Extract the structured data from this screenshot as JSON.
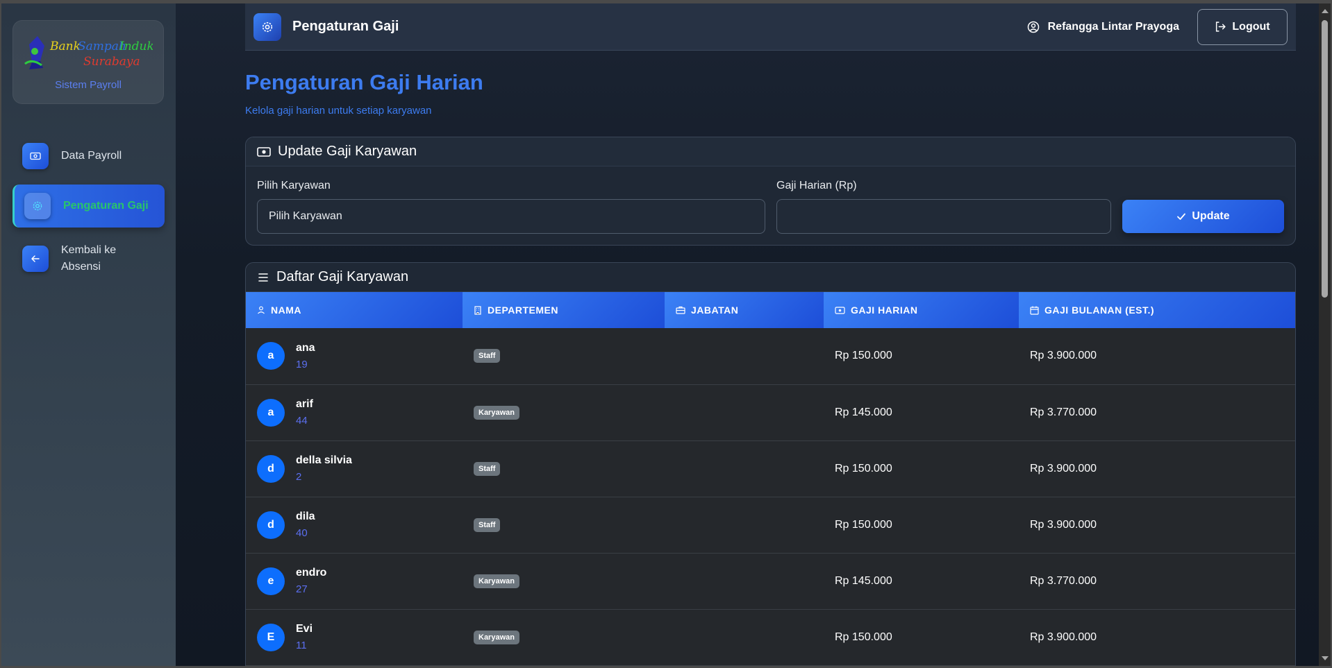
{
  "sidebar": {
    "logo_alt": "Bank Sampah Induk Surabaya",
    "subtitle": "Sistem Payroll",
    "items": [
      {
        "label": "Data Payroll",
        "icon": "cash-icon",
        "active": false
      },
      {
        "label": "Pengaturan Gaji",
        "icon": "gear-icon",
        "active": true
      },
      {
        "label": "Kembali ke Absensi",
        "icon": "arrow-left-icon",
        "active": false
      }
    ]
  },
  "topbar": {
    "title": "Pengaturan Gaji",
    "user_name": "Refangga Lintar Prayoga",
    "logout_label": "Logout"
  },
  "page": {
    "title": "Pengaturan Gaji Harian",
    "subtitle": "Kelola gaji harian untuk setiap karyawan"
  },
  "update_form": {
    "heading": "Update Gaji Karyawan",
    "employee_label": "Pilih Karyawan",
    "employee_selected": "Pilih Karyawan",
    "wage_label": "Gaji Harian (Rp)",
    "wage_value": "",
    "submit_label": "Update"
  },
  "salary_list": {
    "heading": "Daftar Gaji Karyawan",
    "columns": [
      "NAMA",
      "DEPARTEMEN",
      "JABATAN",
      "GAJI HARIAN",
      "GAJI BULANAN (EST.)"
    ],
    "rows": [
      {
        "initial": "a",
        "name": "ana",
        "id": "19",
        "department": "Staff",
        "position": "",
        "daily": "Rp 150.000",
        "monthly": "Rp 3.900.000"
      },
      {
        "initial": "a",
        "name": "arif",
        "id": "44",
        "department": "Karyawan",
        "position": "",
        "daily": "Rp 145.000",
        "monthly": "Rp 3.770.000"
      },
      {
        "initial": "d",
        "name": "della silvia",
        "id": "2",
        "department": "Staff",
        "position": "",
        "daily": "Rp 150.000",
        "monthly": "Rp 3.900.000"
      },
      {
        "initial": "d",
        "name": "dila",
        "id": "40",
        "department": "Staff",
        "position": "",
        "daily": "Rp 150.000",
        "monthly": "Rp 3.900.000"
      },
      {
        "initial": "e",
        "name": "endro",
        "id": "27",
        "department": "Karyawan",
        "position": "",
        "daily": "Rp 145.000",
        "monthly": "Rp 3.770.000"
      },
      {
        "initial": "E",
        "name": "Evi",
        "id": "11",
        "department": "Karyawan",
        "position": "",
        "daily": "Rp 150.000",
        "monthly": "Rp 3.900.000"
      }
    ]
  },
  "colors": {
    "accent": "#3b82f6",
    "accent_dark": "#1d4ed8",
    "active_text": "#29c56b",
    "badge": "#6c757d"
  }
}
